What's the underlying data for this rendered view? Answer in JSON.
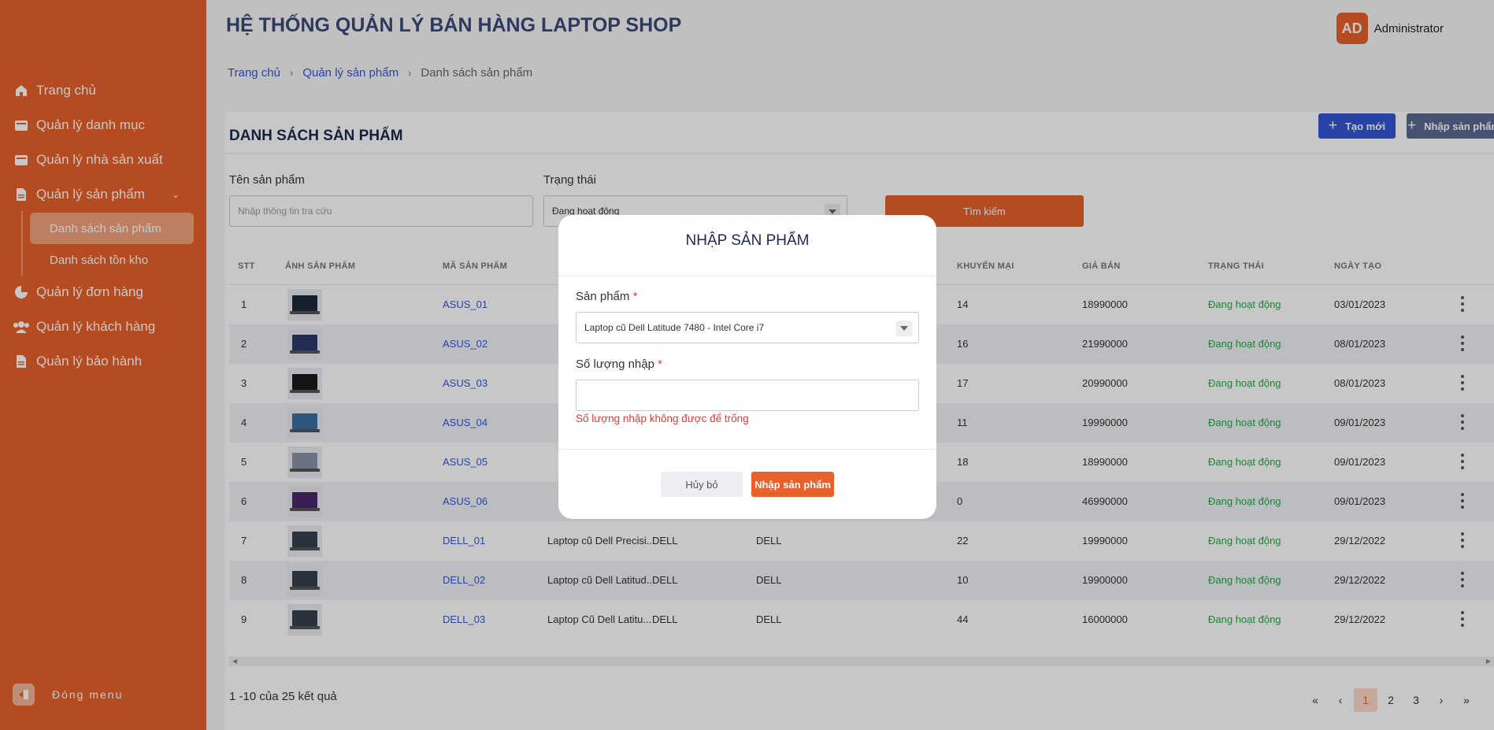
{
  "sidebar": {
    "items": [
      {
        "label": "Trang chủ",
        "icon": "home-icon"
      },
      {
        "label": "Quản lý danh mục",
        "icon": "folder-icon"
      },
      {
        "label": "Quản lý nhà sản xuất",
        "icon": "folder-icon"
      },
      {
        "label": "Quản lý sản phẩm",
        "icon": "file-icon"
      },
      {
        "label": "Quản lý đơn hàng",
        "icon": "pie-chart-icon"
      },
      {
        "label": "Quản lý khách hàng",
        "icon": "users-icon"
      },
      {
        "label": "Quản lý bảo hành",
        "icon": "file-icon"
      }
    ],
    "sub_items": [
      "Danh sách sản phẩm",
      "Danh sách tồn kho"
    ],
    "close_menu": "Đóng menu"
  },
  "header": {
    "title": "HỆ THỐNG QUẢN LÝ BÁN HÀNG LAPTOP SHOP",
    "avatar": "AD",
    "user": "Administrator"
  },
  "breadcrumb": [
    "Trang chủ",
    "Quản lý sản phẩm",
    "Danh sách sản phẩm"
  ],
  "page": {
    "title": "DANH SÁCH SẢN PHẨM",
    "create_button": "Tạo mới",
    "import_button": "Nhập sản phẩm"
  },
  "filters": {
    "name_label": "Tên sản phẩm",
    "name_placeholder": "Nhập thông tin tra cứu",
    "status_label": "Trạng thái",
    "status_value": "Đang hoạt động",
    "search_button": "Tìm kiếm"
  },
  "table": {
    "columns": [
      "STT",
      "ẢNH SẢN PHẨM",
      "MÃ SẢN PHẨM",
      "KHUYẾN MẠI",
      "GIÁ BÁN",
      "TRẠNG THÁI",
      "NGÀY TẠO"
    ],
    "rows": [
      {
        "stt": "1",
        "code": "ASUS_01",
        "name": "",
        "cat": "",
        "brand": "",
        "promo": "14",
        "price": "18990000",
        "status": "Đang hoạt động",
        "date": "03/01/2023"
      },
      {
        "stt": "2",
        "code": "ASUS_02",
        "name": "",
        "cat": "",
        "brand": "",
        "promo": "16",
        "price": "21990000",
        "status": "Đang hoạt động",
        "date": "08/01/2023"
      },
      {
        "stt": "3",
        "code": "ASUS_03",
        "name": "",
        "cat": "",
        "brand": "",
        "promo": "17",
        "price": "20990000",
        "status": "Đang hoạt động",
        "date": "08/01/2023"
      },
      {
        "stt": "4",
        "code": "ASUS_04",
        "name": "",
        "cat": "",
        "brand": "",
        "promo": "11",
        "price": "19990000",
        "status": "Đang hoạt động",
        "date": "09/01/2023"
      },
      {
        "stt": "5",
        "code": "ASUS_05",
        "name": "",
        "cat": "",
        "brand": "",
        "promo": "18",
        "price": "18990000",
        "status": "Đang hoạt động",
        "date": "09/01/2023"
      },
      {
        "stt": "6",
        "code": "ASUS_06",
        "name": "",
        "cat": "",
        "brand": "",
        "promo": "0",
        "price": "46990000",
        "status": "Đang hoạt động",
        "date": "09/01/2023"
      },
      {
        "stt": "7",
        "code": "DELL_01",
        "name": "Laptop cũ Dell Precisi...",
        "cat": "DELL",
        "brand": "DELL",
        "promo": "22",
        "price": "19990000",
        "status": "Đang hoạt động",
        "date": "29/12/2022"
      },
      {
        "stt": "8",
        "code": "DELL_02",
        "name": "Laptop cũ Dell Latitud...",
        "cat": "DELL",
        "brand": "DELL",
        "promo": "10",
        "price": "19900000",
        "status": "Đang hoạt động",
        "date": "29/12/2022"
      },
      {
        "stt": "9",
        "code": "DELL_03",
        "name": "Laptop Cũ Dell Latitu...",
        "cat": "DELL",
        "brand": "DELL",
        "promo": "44",
        "price": "16000000",
        "status": "Đang hoạt động",
        "date": "29/12/2022"
      }
    ]
  },
  "pagination": {
    "result_text": "1 -10 của 25 kết quả",
    "first": "«",
    "prev": "‹",
    "pages": [
      "1",
      "2",
      "3"
    ],
    "next": "›",
    "last": "»"
  },
  "modal": {
    "title": "NHẬP SẢN PHẨM",
    "product_label": "Sản phẩm",
    "required_mark": "*",
    "product_value": "Laptop cũ Dell Latitude 7480 - Intel Core i7",
    "quantity_label": "Số lượng nhập",
    "quantity_value": "",
    "error": "Số lượng nhập không được để trống",
    "cancel_button": "Hủy bỏ",
    "submit_button": "Nhập sản phẩm"
  },
  "colors": {
    "brand": "#e8612a",
    "primary": "#3457d5",
    "success": "#2aa64a",
    "error": "#e53935"
  }
}
